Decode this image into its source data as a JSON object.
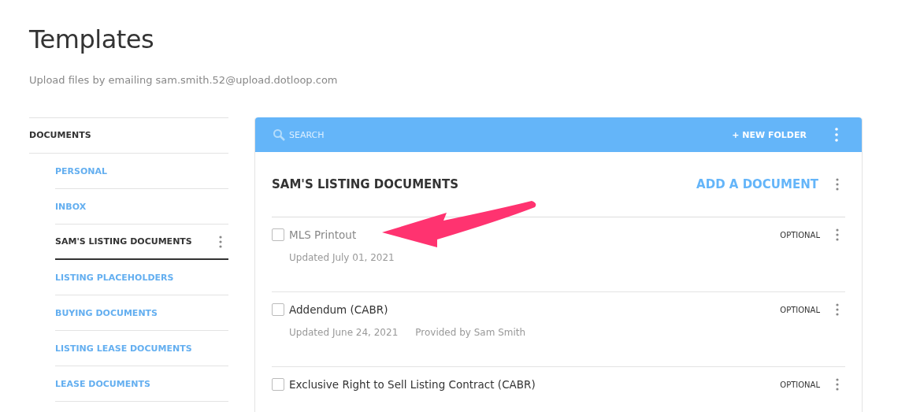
{
  "page": {
    "title": "Templates",
    "subtitle": "Upload files by emailing sam.smith.52@upload.dotloop.com"
  },
  "sidebar": {
    "heading": "DOCUMENTS",
    "items": [
      {
        "label": "PERSONAL",
        "selected": false
      },
      {
        "label": "INBOX",
        "selected": false
      },
      {
        "label": "SAM'S LISTING DOCUMENTS",
        "selected": true
      },
      {
        "label": "LISTING PLACEHOLDERS",
        "selected": false
      },
      {
        "label": "BUYING DOCUMENTS",
        "selected": false
      },
      {
        "label": "LISTING LEASE DOCUMENTS",
        "selected": false
      },
      {
        "label": "LEASE DOCUMENTS",
        "selected": false
      }
    ]
  },
  "toolbar": {
    "search_placeholder": "SEARCH",
    "new_folder": "NEW FOLDER",
    "new_folder_icon": "+"
  },
  "folder": {
    "title": "SAM'S LISTING DOCUMENTS",
    "add_button": "ADD A DOCUMENT"
  },
  "documents": [
    {
      "name": "MLS Printout",
      "disabled": true,
      "checked": false,
      "status": "OPTIONAL",
      "updated": "Updated July 01, 2021"
    },
    {
      "name": "Addendum (CABR)",
      "disabled": false,
      "checked": false,
      "status": "OPTIONAL",
      "updated": "Updated June 24, 2021",
      "provided_by": "Provided by Sam Smith"
    },
    {
      "name": "Exclusive Right to Sell Listing Contract (CABR)",
      "disabled": false,
      "checked": false,
      "status": "OPTIONAL"
    }
  ]
}
